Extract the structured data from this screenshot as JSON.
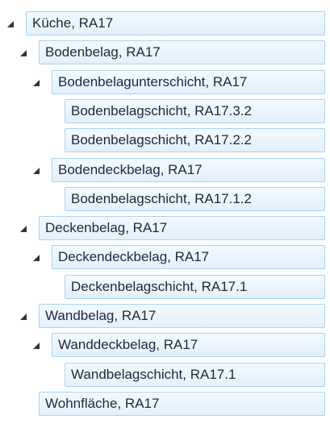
{
  "tree": {
    "expanded_icon": "triangle-expanded-icon",
    "colors": {
      "node_border": "#a9d3f5",
      "node_fill": "#e3f0fc",
      "text": "#1d2a3a",
      "arrow": "#333333"
    },
    "nodes": [
      {
        "label": "Küche, RA17",
        "level": 0,
        "expanded": true
      },
      {
        "label": "Bodenbelag, RA17",
        "level": 1,
        "expanded": true
      },
      {
        "label": "Bodenbelagunterschicht, RA17",
        "level": 2,
        "expanded": true
      },
      {
        "label": "Bodenbelagschicht, RA17.3.2",
        "level": 3,
        "expanded": false
      },
      {
        "label": "Bodenbelagschicht, RA17.2.2",
        "level": 3,
        "expanded": false
      },
      {
        "label": "Bodendeckbelag, RA17",
        "level": 2,
        "expanded": true
      },
      {
        "label": "Bodenbelagschicht, RA17.1.2",
        "level": 3,
        "expanded": false
      },
      {
        "label": "Deckenbelag, RA17",
        "level": 1,
        "expanded": true
      },
      {
        "label": "Deckendeckbelag, RA17",
        "level": 2,
        "expanded": true
      },
      {
        "label": "Deckenbelagschicht, RA17.1",
        "level": 3,
        "expanded": false
      },
      {
        "label": "Wandbelag, RA17",
        "level": 1,
        "expanded": true
      },
      {
        "label": "Wanddeckbelag, RA17",
        "level": 2,
        "expanded": true
      },
      {
        "label": "Wandbelagschicht, RA17.1",
        "level": 3,
        "expanded": false
      },
      {
        "label": "Wohnfläche, RA17",
        "level": 1,
        "expanded": false
      }
    ]
  }
}
